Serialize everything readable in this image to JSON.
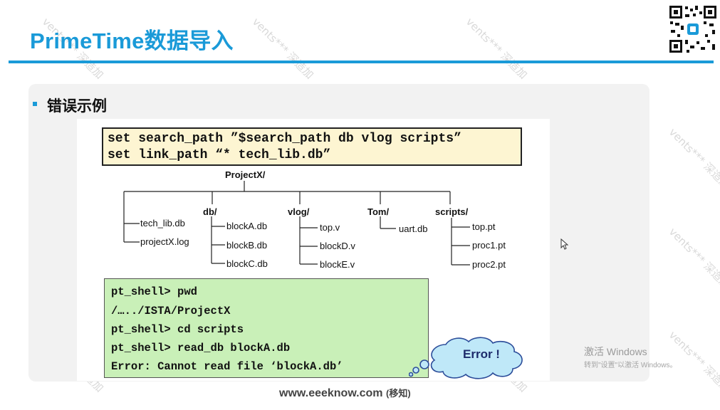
{
  "header": {
    "title": "PrimeTime数据导入"
  },
  "section": {
    "heading": "错误示例"
  },
  "code_box": {
    "line1": "set search_path ”$search_path db vlog scripts”",
    "line2": "set link_path “* tech_lib.db”"
  },
  "tree": {
    "root": "ProjectX/",
    "root_files": [
      "tech_lib.db",
      "projectX.log"
    ],
    "folders": [
      {
        "name": "db/",
        "files": [
          "blockA.db",
          "blockB.db",
          "blockC.db"
        ]
      },
      {
        "name": "vlog/",
        "files": [
          "top.v",
          "blockD.v",
          "blockE.v"
        ]
      },
      {
        "name": "Tom/",
        "files": [
          "uart.db"
        ]
      },
      {
        "name": "scripts/",
        "files": [
          "top.pt",
          "proc1.pt",
          "proc2.pt"
        ]
      }
    ]
  },
  "shell": {
    "lines": [
      "pt_shell> pwd",
      "/…../ISTA/ProjectX",
      "pt_shell> cd scripts",
      "pt_shell> read_db blockA.db",
      "Error: Cannot read file ‘blockA.db’"
    ]
  },
  "callout": {
    "label": "Error !"
  },
  "footer": {
    "site": "www.eeeknow.com",
    "suffix": "(移知)"
  },
  "windows_activation": {
    "title": "激活 Windows",
    "subtitle": "转到\"设置\"以激活 Windows。"
  },
  "watermark": {
    "text": "vents*** 深造加"
  },
  "colors": {
    "accent": "#1a9ad8",
    "code_bg": "#fdf5d2",
    "shell_bg": "#c9f0b8",
    "cloud_fill": "#bfe8f8"
  },
  "icons": [
    "qr-code-icon",
    "mouse-cursor-icon"
  ]
}
